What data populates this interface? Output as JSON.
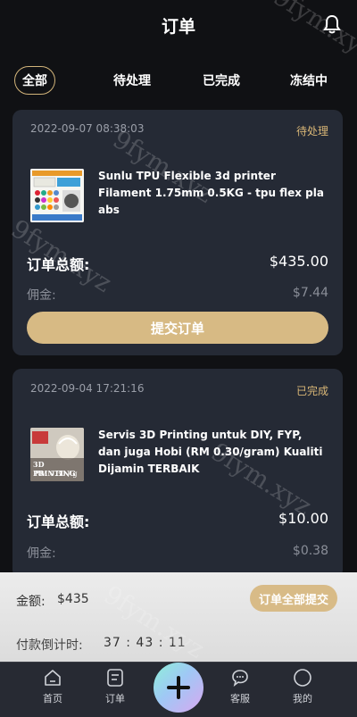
{
  "header": {
    "title": "订单"
  },
  "tabs": [
    {
      "label": "全部",
      "active": true
    },
    {
      "label": "待处理",
      "active": false
    },
    {
      "label": "已完成",
      "active": false
    },
    {
      "label": "冻结中",
      "active": false
    }
  ],
  "orders": [
    {
      "date": "2022-09-07 08:38:03",
      "status": "待处理",
      "product_title": "Sunlu TPU Flexible 3d printer Filament 1.75mm 0.5KG - tpu flex pla abs",
      "total_label": "订单总额:",
      "total_value": "$435.00",
      "commission_label": "佣金:",
      "commission_value": "$7.44",
      "submit_label": "提交订单"
    },
    {
      "date": "2022-09-04 17:21:16",
      "status": "已完成",
      "product_title": "Servis 3D Printing untuk DIY, FYP, dan juga Hobi (RM 0.30/gram) Kualiti Dijamin TERBAIK",
      "thumb_text_1": "3D PRINTING",
      "thumb_text_2": "RM 0.30 / g",
      "total_label": "订单总额:",
      "total_value": "$10.00",
      "commission_label": "佣金:",
      "commission_value": "$0.38"
    }
  ],
  "summary": {
    "amount_label": "金额:",
    "amount_value": "$435",
    "submit_all_label": "订单全部提交",
    "countdown_label": "付款倒计时:",
    "countdown_value": "37 : 43 : 11"
  },
  "nav": {
    "items": [
      {
        "label": "首页",
        "icon": "home-icon"
      },
      {
        "label": "订单",
        "icon": "orders-icon"
      },
      {
        "label": "客服",
        "icon": "chat-icon"
      },
      {
        "label": "我的",
        "icon": "profile-icon"
      }
    ],
    "fab_icon": "plus-icon"
  },
  "watermark": "9fym.xyz",
  "colors": {
    "accent_gold": "#d7ba84",
    "card_bg": "#252a35",
    "page_bg": "#101114"
  }
}
